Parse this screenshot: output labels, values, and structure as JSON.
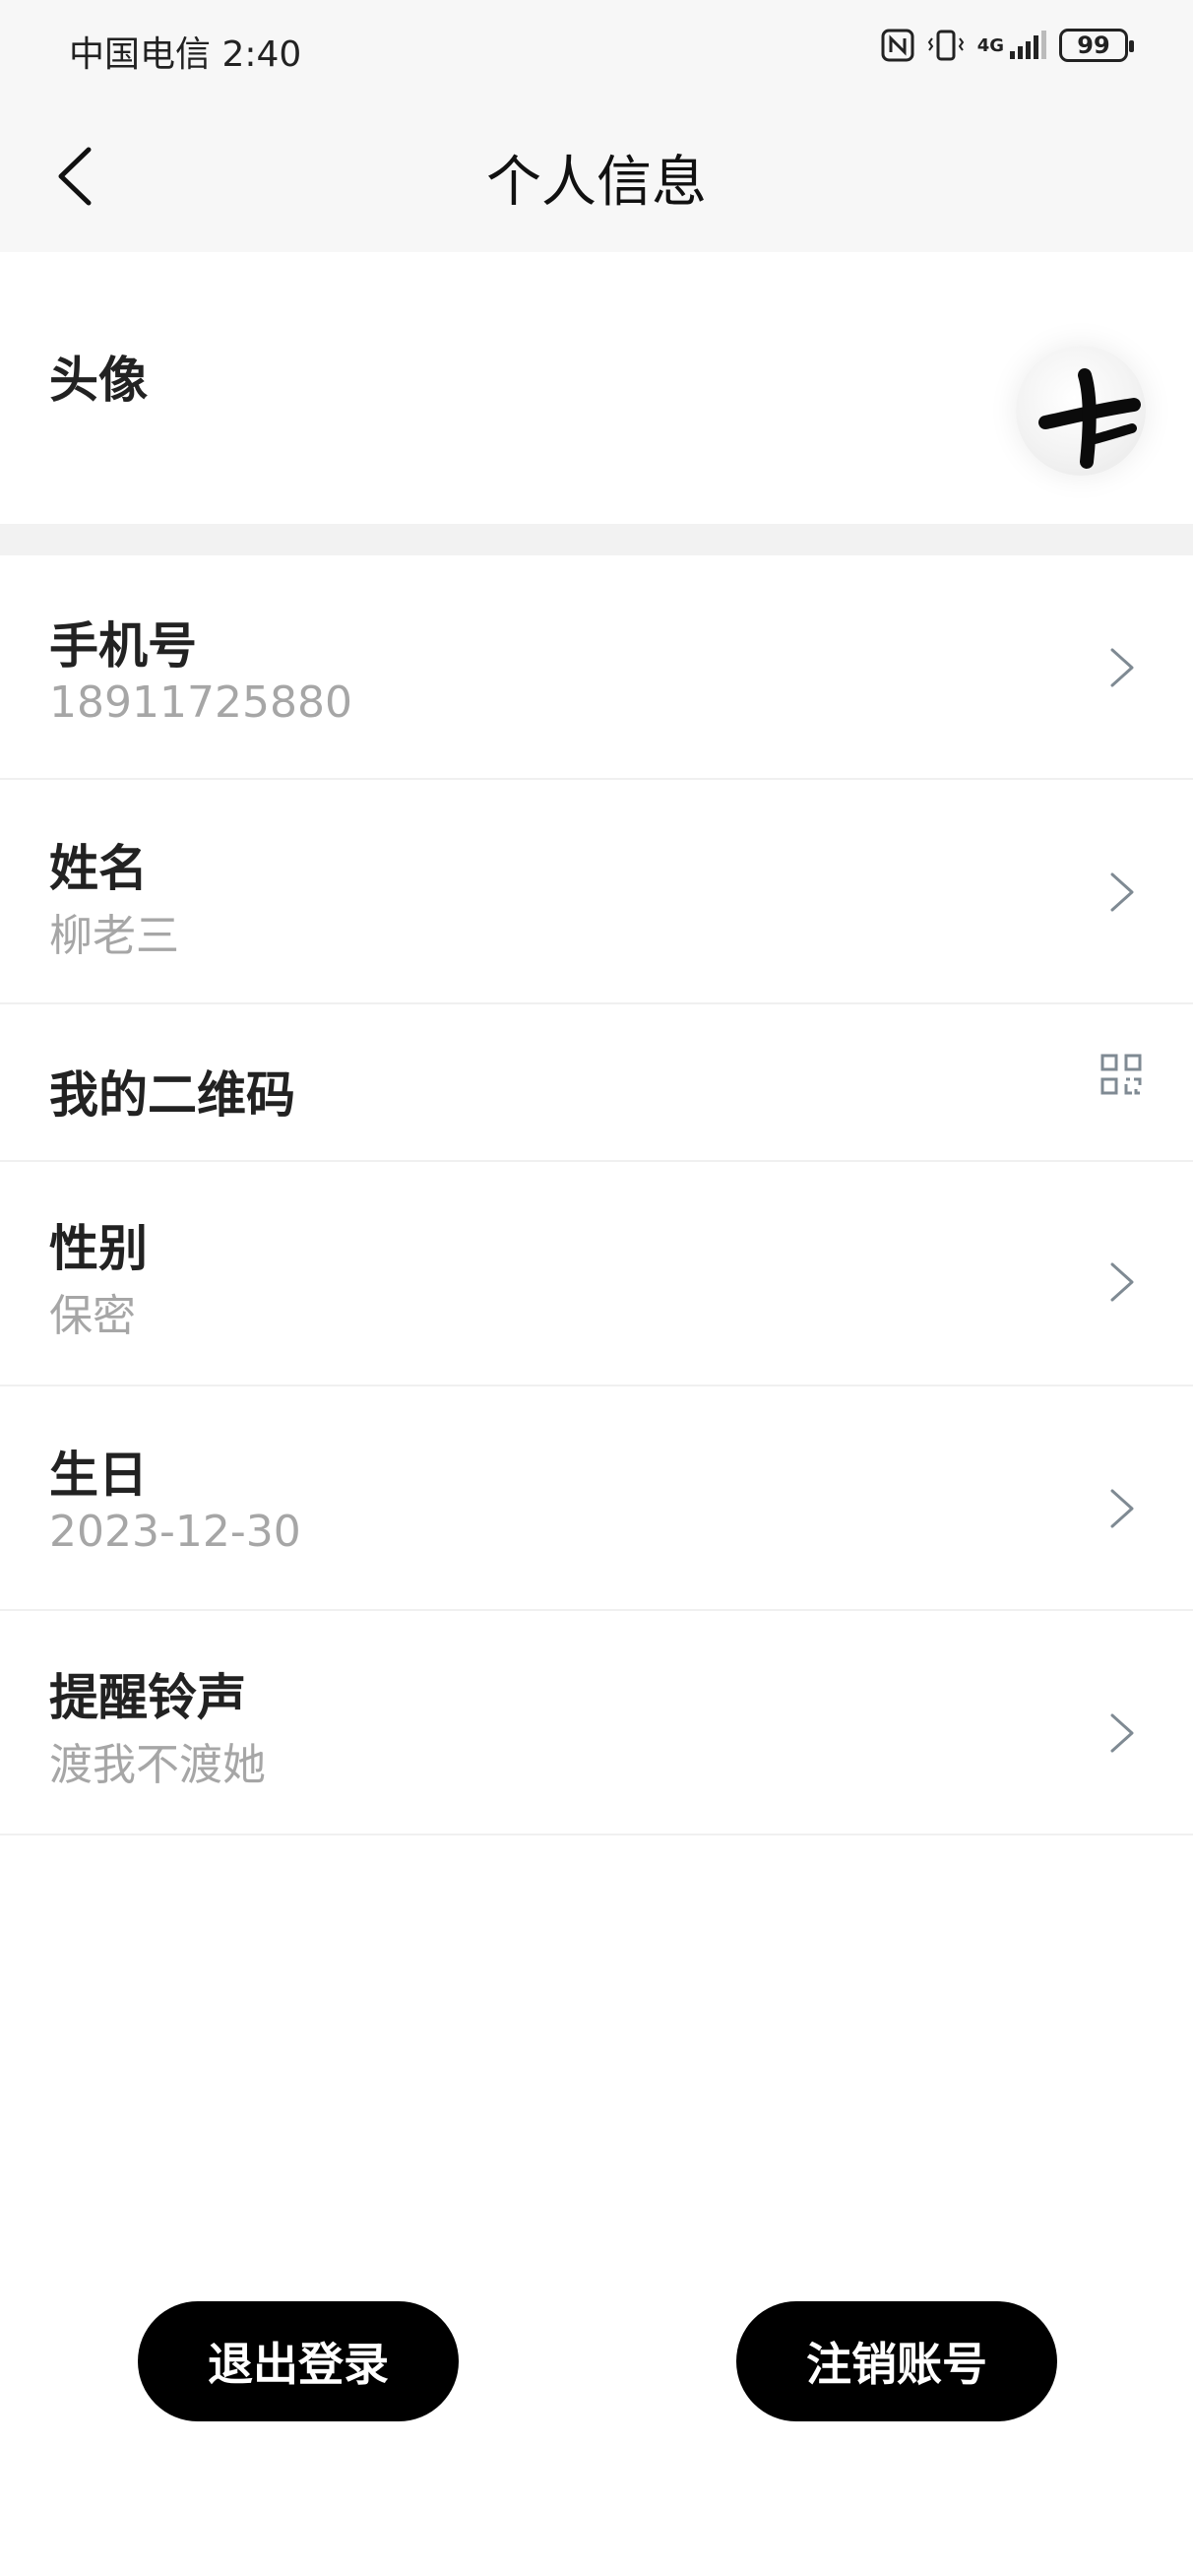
{
  "status_bar": {
    "carrier_time": "中国电信 2:40",
    "network_label": "4G",
    "battery": "99"
  },
  "header": {
    "title": "个人信息",
    "back_icon": "chevron-left-icon"
  },
  "avatar_row": {
    "label": "头像"
  },
  "items": [
    {
      "label": "手机号",
      "value": "18911725880",
      "action_icon": "chevron-right-icon"
    },
    {
      "label": "姓名",
      "value": "柳老三",
      "action_icon": "chevron-right-icon"
    },
    {
      "label": "我的二维码",
      "value": "",
      "action_icon": "qr-code-icon"
    },
    {
      "label": "性别",
      "value": "保密",
      "action_icon": "chevron-right-icon"
    },
    {
      "label": "生日",
      "value": "2023-12-30",
      "action_icon": "chevron-right-icon"
    },
    {
      "label": "提醒铃声",
      "value": "渡我不渡她",
      "action_icon": "chevron-right-icon"
    }
  ],
  "buttons": {
    "logout": "退出登录",
    "cancel_account": "注销账号"
  },
  "colors": {
    "header_bg": "#f7f7f7",
    "value_text": "#a6a6a6",
    "button_bg": "#000000",
    "chevron": "#7f8a93"
  }
}
